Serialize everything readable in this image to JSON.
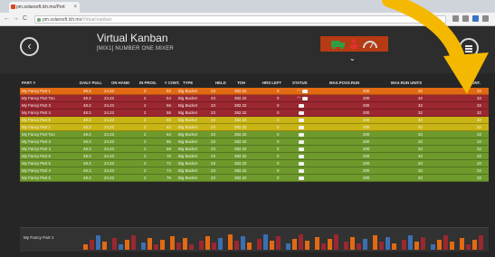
{
  "browser": {
    "tab_title": "pm.solarsoft.lch.mx/Port",
    "tab_close": "×",
    "back_glyph": "←",
    "forward_glyph": "→",
    "reload_glyph": "C",
    "url_host": "pm.solarsoft.lch.mx",
    "url_path": "/Virtual-kanban"
  },
  "header": {
    "back_glyph": "‹",
    "title": "Virtual Kanban",
    "subtitle": "[MIX1] NUMBER ONE MIXER",
    "chevron_glyph": "⌄",
    "status_icons": [
      "truck-icon",
      "person-icon",
      "gauge-icon"
    ]
  },
  "columns": {
    "part": "PART #",
    "daily_pull": "DAILY PULL",
    "on_hand": "ON HAND",
    "in_prog": "IN PROG.",
    "cont": "# CONT.",
    "type": "TYPE",
    "held": "HELD",
    "toh": "TOH",
    "hrs_left": "HRS LEFT",
    "status": "STATUS",
    "max_poss_run": "MAX.POSS.RUN",
    "max_run_units": "MAX.RUN UNITS",
    "cont2": "CONT."
  },
  "rows": [
    {
      "part": "My Fancy Part 1",
      "pull": "48.3",
      "hand": "24.23",
      "prog": "2",
      "cont": "52",
      "type": "Big Bucket",
      "held": "23",
      "toh": "382.32",
      "hrs": "0",
      "max": "200",
      "units": "32",
      "cont2": "32",
      "status": "truck-gauge"
    },
    {
      "part": "My Fancy Part Too",
      "pull": "48.3",
      "hand": "24.23",
      "prog": "2",
      "cont": "54",
      "type": "Big Bucket",
      "held": "23",
      "toh": "382.32",
      "hrs": "0",
      "max": "200",
      "units": "32",
      "cont2": "32",
      "status": "truck-gauge"
    },
    {
      "part": "My Fancy Part 3",
      "pull": "48.3",
      "hand": "24.23",
      "prog": "2",
      "cont": "56",
      "type": "Big Bucket",
      "held": "23",
      "toh": "382.32",
      "hrs": "0",
      "max": "200",
      "units": "32",
      "cont2": "32",
      "status": "truck"
    },
    {
      "part": "My Fancy Part 4",
      "pull": "48.3",
      "hand": "24.23",
      "prog": "2",
      "cont": "58",
      "type": "Big Bucket",
      "held": "23",
      "toh": "382.32",
      "hrs": "0",
      "max": "200",
      "units": "32",
      "cont2": "32",
      "status": "truck"
    },
    {
      "part": "My Fancy Part 5",
      "pull": "48.3",
      "hand": "24.23",
      "prog": "2",
      "cont": "60",
      "type": "Big Bucket",
      "held": "23",
      "toh": "382.32",
      "hrs": "0",
      "max": "200",
      "units": "32",
      "cont2": "32",
      "status": "truck"
    },
    {
      "part": "My Fancy Part 1",
      "pull": "48.3",
      "hand": "24.23",
      "prog": "2",
      "cont": "62",
      "type": "Big Bucket",
      "held": "23",
      "toh": "382.32",
      "hrs": "0",
      "max": "200",
      "units": "32",
      "cont2": "32",
      "status": "truck"
    },
    {
      "part": "My Fancy Part Too",
      "pull": "48.3",
      "hand": "24.23",
      "prog": "2",
      "cont": "64",
      "type": "Big Bucket",
      "held": "23",
      "toh": "382.32",
      "hrs": "0",
      "max": "200",
      "units": "32",
      "cont2": "32",
      "status": "truck"
    },
    {
      "part": "My Fancy Part 3",
      "pull": "48.3",
      "hand": "24.23",
      "prog": "2",
      "cont": "66",
      "type": "Big Bucket",
      "held": "23",
      "toh": "382.32",
      "hrs": "0",
      "max": "200",
      "units": "32",
      "cont2": "32",
      "status": "truck"
    },
    {
      "part": "My Fancy Part 4",
      "pull": "48.3",
      "hand": "24.23",
      "prog": "2",
      "cont": "68",
      "type": "Big Bucket",
      "held": "23",
      "toh": "382.32",
      "hrs": "0",
      "max": "200",
      "units": "32",
      "cont2": "32",
      "status": "truck"
    },
    {
      "part": "My Fancy Part 5",
      "pull": "48.3",
      "hand": "24.23",
      "prog": "2",
      "cont": "70",
      "type": "Big Bucket",
      "held": "23",
      "toh": "382.32",
      "hrs": "0",
      "max": "200",
      "units": "32",
      "cont2": "32",
      "status": "truck"
    },
    {
      "part": "My Fancy Part 5",
      "pull": "48.3",
      "hand": "24.23",
      "prog": "2",
      "cont": "72",
      "type": "Big Bucket",
      "held": "23",
      "toh": "382.32",
      "hrs": "0",
      "max": "200",
      "units": "32",
      "cont2": "32",
      "status": "truck"
    },
    {
      "part": "My Fancy Part 4",
      "pull": "48.3",
      "hand": "24.23",
      "prog": "2",
      "cont": "74",
      "type": "Big Bucket",
      "held": "23",
      "toh": "382.32",
      "hrs": "0",
      "max": "200",
      "units": "32",
      "cont2": "32",
      "status": "truck"
    },
    {
      "part": "My Fancy Part 5",
      "pull": "48.3",
      "hand": "24.23",
      "prog": "2",
      "cont": "76",
      "type": "Big Bucket",
      "held": "23",
      "toh": "382.32",
      "hrs": "0",
      "max": "200",
      "units": "32",
      "cont2": "32",
      "status": "truck"
    }
  ],
  "row_colors": [
    "#e26a12",
    "#9b2730",
    "#9b2730",
    "#9b2730",
    "#c8b414",
    "#c8b414",
    "#6e9a2c",
    "#6e9a2c",
    "#6e9a2c",
    "#6e9a2c",
    "#6e9a2c",
    "#6e9a2c",
    "#6e9a2c"
  ],
  "strip": {
    "label": "My Fancy Part 1"
  },
  "colors": {
    "app_bg": "#262626",
    "status_box": "#b63a13",
    "pointer_arrow": "#f5b800",
    "truck_icon": "#2f9e44",
    "person_icon": "#e03131",
    "gauge_icon": "#d9d9d9"
  }
}
